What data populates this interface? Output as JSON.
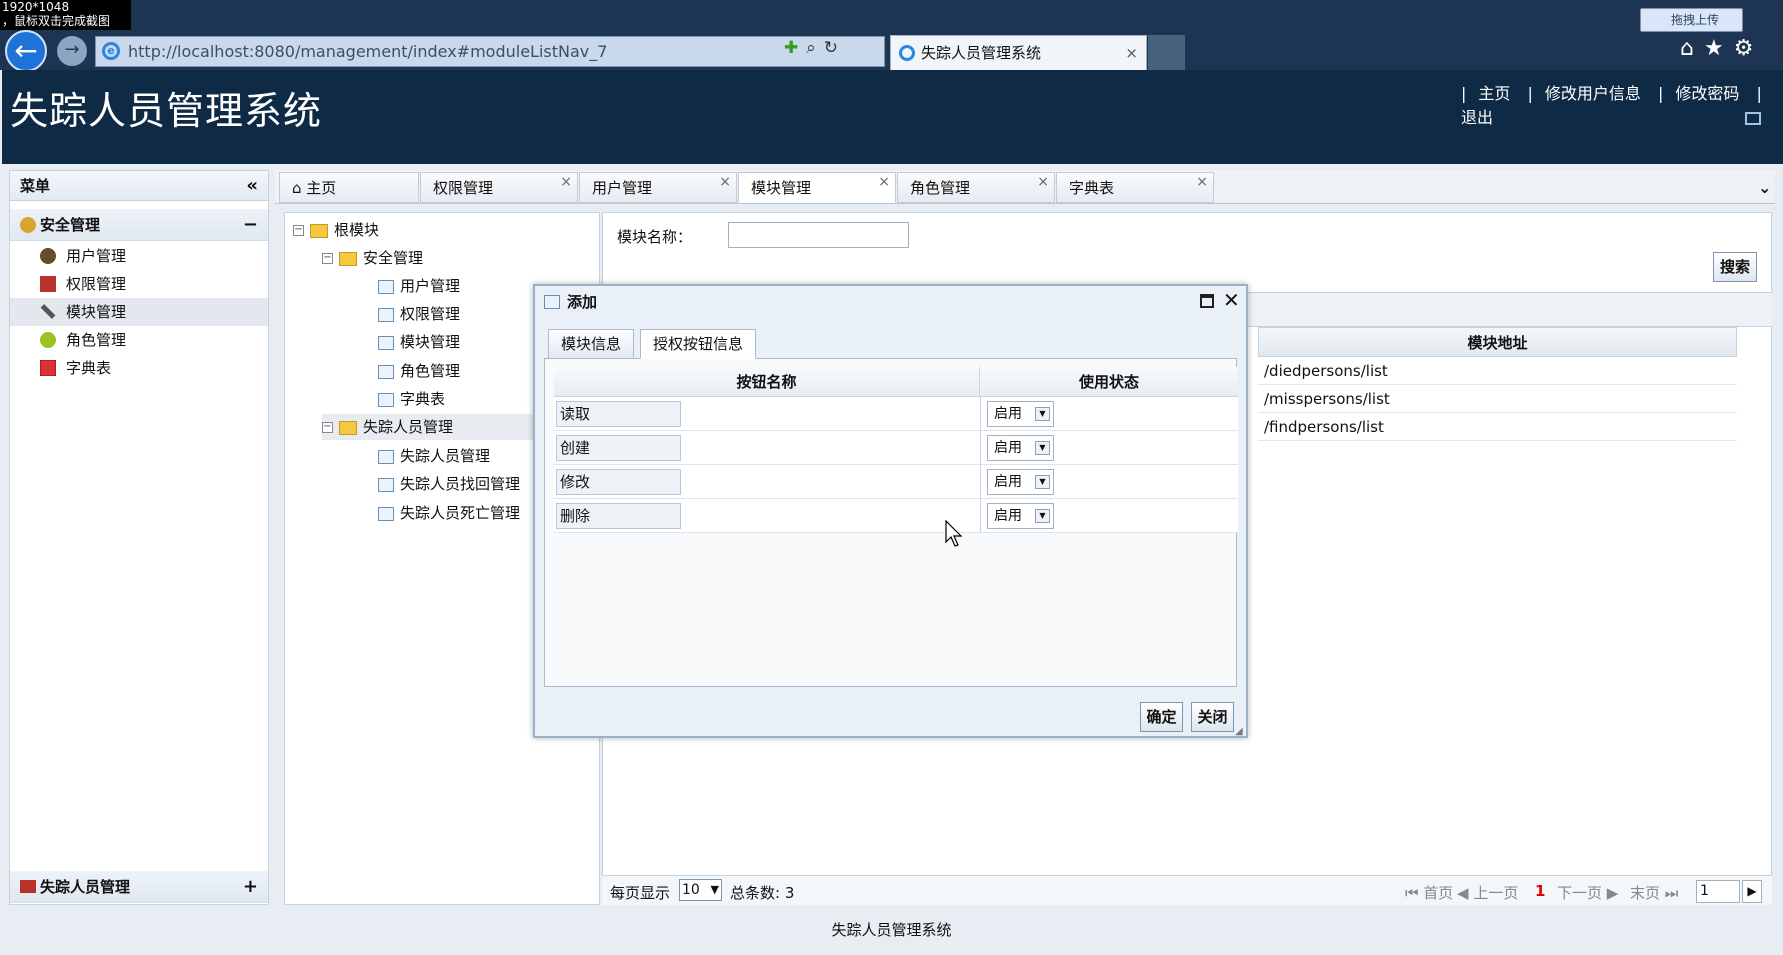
{
  "capture": {
    "line1": "1920*1048",
    "line2": "，鼠标双击完成截图"
  },
  "browser": {
    "url": "http://localhost:8080/management/index#moduleListNav_7",
    "tab_title": "失踪人员管理系统",
    "upload_label": "拖拽上传"
  },
  "app": {
    "title": "失踪人员管理系统",
    "links": [
      "主页",
      "修改用户信息",
      "修改密码",
      "退出"
    ]
  },
  "menu": {
    "title": "菜单",
    "group1": "安全管理",
    "items": [
      "用户管理",
      "权限管理",
      "模块管理",
      "角色管理",
      "字典表"
    ],
    "group2": "失踪人员管理"
  },
  "tabs": [
    "主页",
    "权限管理",
    "用户管理",
    "模块管理",
    "角色管理",
    "字典表"
  ],
  "tree": {
    "root": "根模块",
    "security": "安全管理",
    "security_items": [
      "用户管理",
      "权限管理",
      "模块管理",
      "角色管理",
      "字典表"
    ],
    "missing": "失踪人员管理",
    "missing_items": [
      "失踪人员管理",
      "失踪人员找回管理",
      "失踪人员死亡管理"
    ]
  },
  "search": {
    "label": "模块名称：",
    "button": "搜索"
  },
  "grid": {
    "header": "模块地址",
    "rows": [
      "/diedpersons/list",
      "/misspersons/list",
      "/findpersons/list"
    ]
  },
  "pager": {
    "per_page_label": "每页显示",
    "per_page": "10",
    "total": "总条数: 3",
    "first": "首页",
    "prev": "上一页",
    "current": "1",
    "next": "下一页",
    "last": "末页",
    "page_input": "1"
  },
  "footer": "失踪人员管理系统",
  "dialog": {
    "title": "添加",
    "tabs": [
      "模块信息",
      "授权按钮信息"
    ],
    "col_name": "按钮名称",
    "col_status": "使用状态",
    "rows": [
      {
        "name": "读取",
        "status": "启用"
      },
      {
        "name": "创建",
        "status": "启用"
      },
      {
        "name": "修改",
        "status": "启用"
      },
      {
        "name": "删除",
        "status": "启用"
      }
    ],
    "ok": "确定",
    "close": "关闭"
  }
}
